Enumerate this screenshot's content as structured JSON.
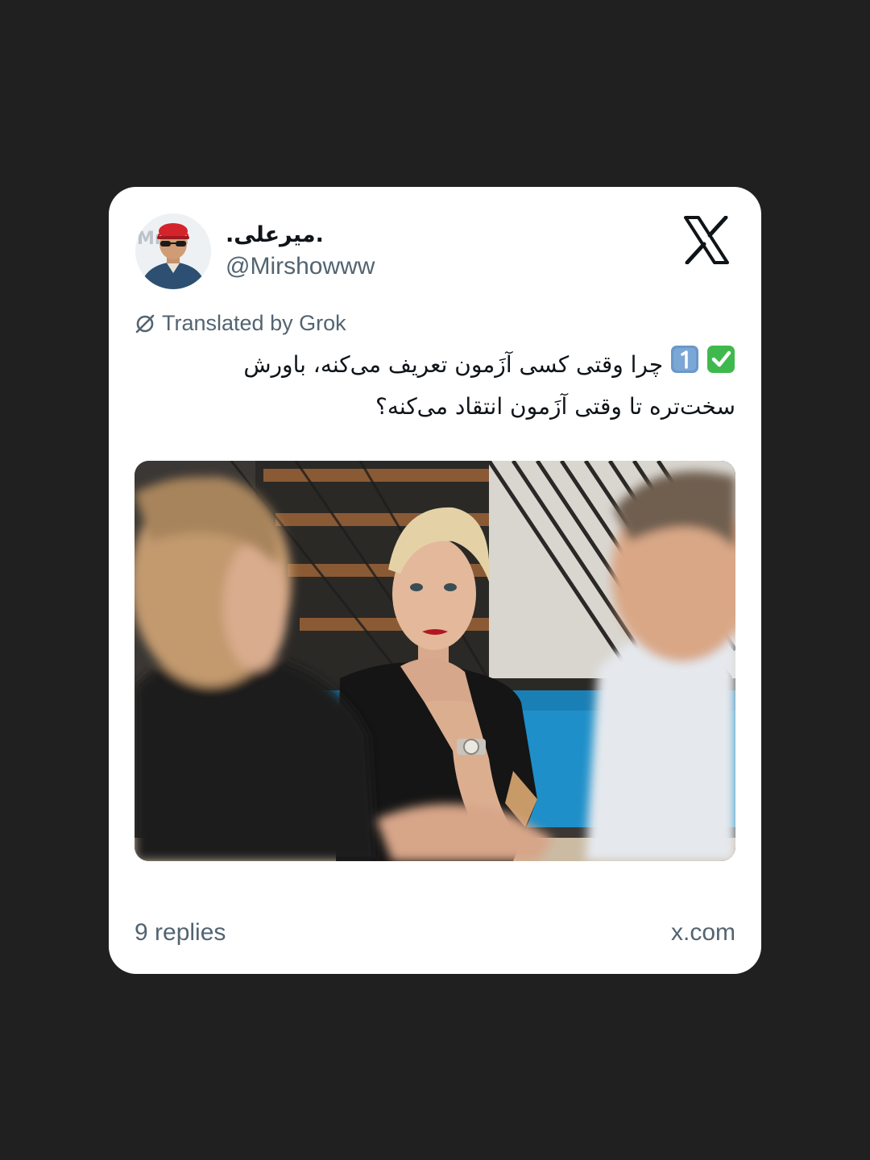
{
  "tweet": {
    "display_name": ".میرعلی.",
    "handle": "@Mirshowww",
    "translated_label": "Translated by Grok",
    "text": "چرا وقتی کسی آزَمون تعریف می‌کنه، باورش سخت‌تره تا وقتی آزَمون انتقاد می‌کنه؟",
    "emojis": [
      "white-heavy-check-mark",
      "keycap-1"
    ],
    "image_subject": "woman-resting-chin-on-hand-listening-to-two-people",
    "avatar_subject": "man-in-red-cap-and-sunglasses"
  },
  "footer": {
    "replies": "9 replies",
    "site": "x.com"
  },
  "icons": {
    "brand": "x-logo-icon",
    "translate": "grok-icon"
  },
  "colors": {
    "background": "#202020",
    "card": "#ffffff",
    "text": "#0f1419",
    "muted": "#536471",
    "check_emoji": "#3fb94e",
    "keycap_emoji": "#6a98c9"
  }
}
